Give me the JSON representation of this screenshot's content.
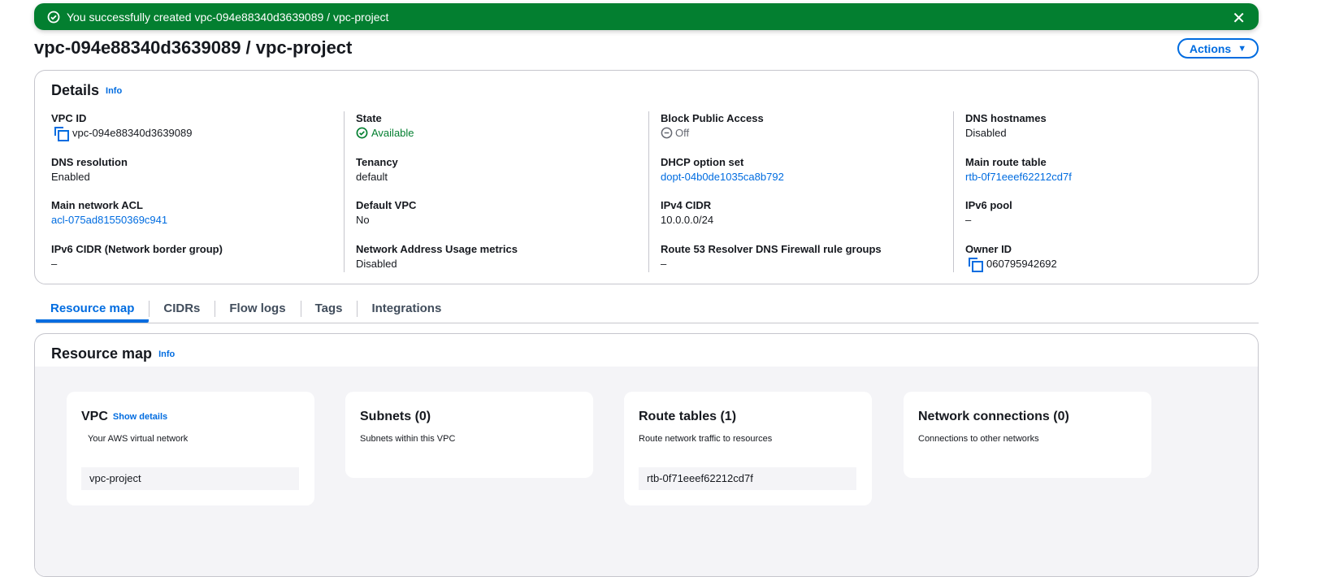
{
  "banner": {
    "message": "You successfully created vpc-094e88340d3639089 / vpc-project",
    "icon": "check-circle-icon",
    "color": "#037f30"
  },
  "header": {
    "title": "vpc-094e88340d3639089 / vpc-project",
    "actions_label": "Actions"
  },
  "details": {
    "title": "Details",
    "info": "Info",
    "columns": [
      [
        {
          "label": "VPC ID",
          "value": "vpc-094e88340d3639089",
          "copy": true
        },
        {
          "label": "DNS resolution",
          "value": "Enabled"
        },
        {
          "label": "Main network ACL",
          "value": "acl-075ad81550369c941",
          "link": true
        },
        {
          "label": "IPv6 CIDR (Network border group)",
          "value": "–"
        }
      ],
      [
        {
          "label": "State",
          "value": "Available",
          "status": "available"
        },
        {
          "label": "Tenancy",
          "value": "default"
        },
        {
          "label": "Default VPC",
          "value": "No"
        },
        {
          "label": "Network Address Usage metrics",
          "value": "Disabled"
        }
      ],
      [
        {
          "label": "Block Public Access",
          "value": "Off",
          "status": "off"
        },
        {
          "label": "DHCP option set",
          "value": "dopt-04b0de1035ca8b792",
          "link": true
        },
        {
          "label": "IPv4 CIDR",
          "value": "10.0.0.0/24"
        },
        {
          "label": "Route 53 Resolver DNS Firewall rule groups",
          "value": "–"
        }
      ],
      [
        {
          "label": "DNS hostnames",
          "value": "Disabled"
        },
        {
          "label": "Main route table",
          "value": "rtb-0f71eeef62212cd7f",
          "link": true
        },
        {
          "label": "IPv6 pool",
          "value": "–"
        },
        {
          "label": "Owner ID",
          "value": "060795942692",
          "copy": true
        }
      ]
    ]
  },
  "tabs": [
    {
      "label": "Resource map",
      "active": true
    },
    {
      "label": "CIDRs"
    },
    {
      "label": "Flow logs"
    },
    {
      "label": "Tags"
    },
    {
      "label": "Integrations"
    }
  ],
  "resource_map": {
    "title": "Resource map",
    "info": "Info",
    "cards": [
      {
        "title": "VPC",
        "link": "Show details",
        "subtitle": "Your AWS virtual network",
        "item": "vpc-project"
      },
      {
        "title": "Subnets (0)",
        "subtitle": "Subnets within this VPC"
      },
      {
        "title": "Route tables (1)",
        "subtitle": "Route network traffic to resources",
        "item": "rtb-0f71eeef62212cd7f"
      },
      {
        "title": "Network connections (0)",
        "subtitle": "Connections to other networks"
      }
    ]
  }
}
